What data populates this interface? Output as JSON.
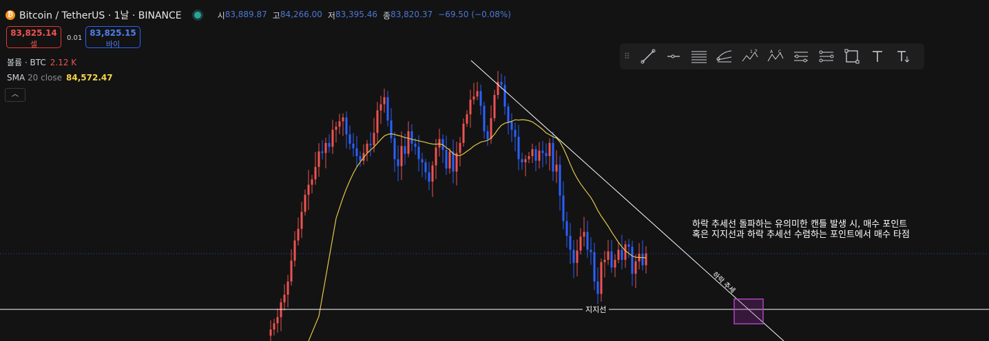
{
  "header": {
    "coin_icon": "bitcoin-icon",
    "title": "Bitcoin / TetherUS · 1날 · BINANCE",
    "ohlc": [
      {
        "label": "시",
        "value": "83,889.87"
      },
      {
        "label": "고",
        "value": "84,266.00"
      },
      {
        "label": "저",
        "value": "83,395.46"
      },
      {
        "label": "종",
        "value": "83,820.37"
      }
    ],
    "change": "−69.50 (−0.08%)"
  },
  "trade": {
    "sell_price": "83,825.14",
    "sell_label": "셀",
    "spread": "0.01",
    "buy_price": "83,825.15",
    "buy_label": "바이"
  },
  "indicators": {
    "volume_label": "볼륨 · BTC",
    "volume_value": "2.12 K",
    "sma_label": "SMA",
    "sma_params": "20 close",
    "sma_value": "84,572.47"
  },
  "toolbar": [
    "trend-line-icon",
    "horizontal-ray-icon",
    "parallel-channel-icon",
    "pitchfork-icon",
    "elliott-wave-icon",
    "abcd-pattern-icon",
    "fib-retracement-icon",
    "fib-extension-icon",
    "rectangle-icon",
    "text-icon",
    "anchored-text-icon"
  ],
  "annotations": {
    "note_line1": "하락 추세선 돌파하는 유의미한 캔틀 발생 시, 매수 포인트",
    "note_line2": "혹은 지지선과 하락 추세선 수렴하는 포인트에서 매수 타점",
    "trend_label": "하락 추세",
    "support_label": "지지선"
  },
  "colors": {
    "up": "#ef5350",
    "down": "#2962ff",
    "sma": "#e6c84a",
    "box": "#9c27b0"
  },
  "chart_data": {
    "type": "candlestick",
    "series": [
      {
        "name": "SMA 20 close",
        "last": 84572.47
      }
    ],
    "support_level_y_approx": 76600,
    "trendline": {
      "from_price_approx": 108000,
      "direction": "down"
    },
    "values_note": "",
    "closes": [
      74000,
      74800,
      75600,
      77500,
      78500,
      80200,
      82900,
      85500,
      87000,
      89200,
      91400,
      92700,
      93400,
      95000,
      97000,
      96800,
      98100,
      97600,
      99800,
      100200,
      100900,
      101400,
      99200,
      98000,
      97400,
      96400,
      95800,
      96800,
      98000,
      97800,
      99400,
      102300,
      103100,
      104000,
      101000,
      98700,
      96000,
      95100,
      97700,
      96700,
      99600,
      98000,
      97600,
      96000,
      95600,
      94300,
      93100,
      95200,
      97500,
      98600,
      97200,
      94800,
      97000,
      94400,
      96800,
      98100,
      100600,
      101800,
      103700,
      104100,
      104800,
      102900,
      99600,
      98600,
      101300,
      104300,
      106000,
      105600,
      102800,
      100800,
      99800,
      98900,
      96000,
      95600,
      96000,
      96400,
      97300,
      95800,
      97100,
      96800,
      96400,
      98100,
      94400,
      95300,
      91300,
      88000,
      86100,
      84300,
      82600,
      84200,
      86000,
      86600,
      84300,
      84000,
      80200,
      78600,
      82700,
      83000,
      84100,
      82000,
      83000,
      84300,
      83000,
      85000,
      84700,
      81200,
      82800,
      83800,
      82300,
      83800
    ]
  }
}
